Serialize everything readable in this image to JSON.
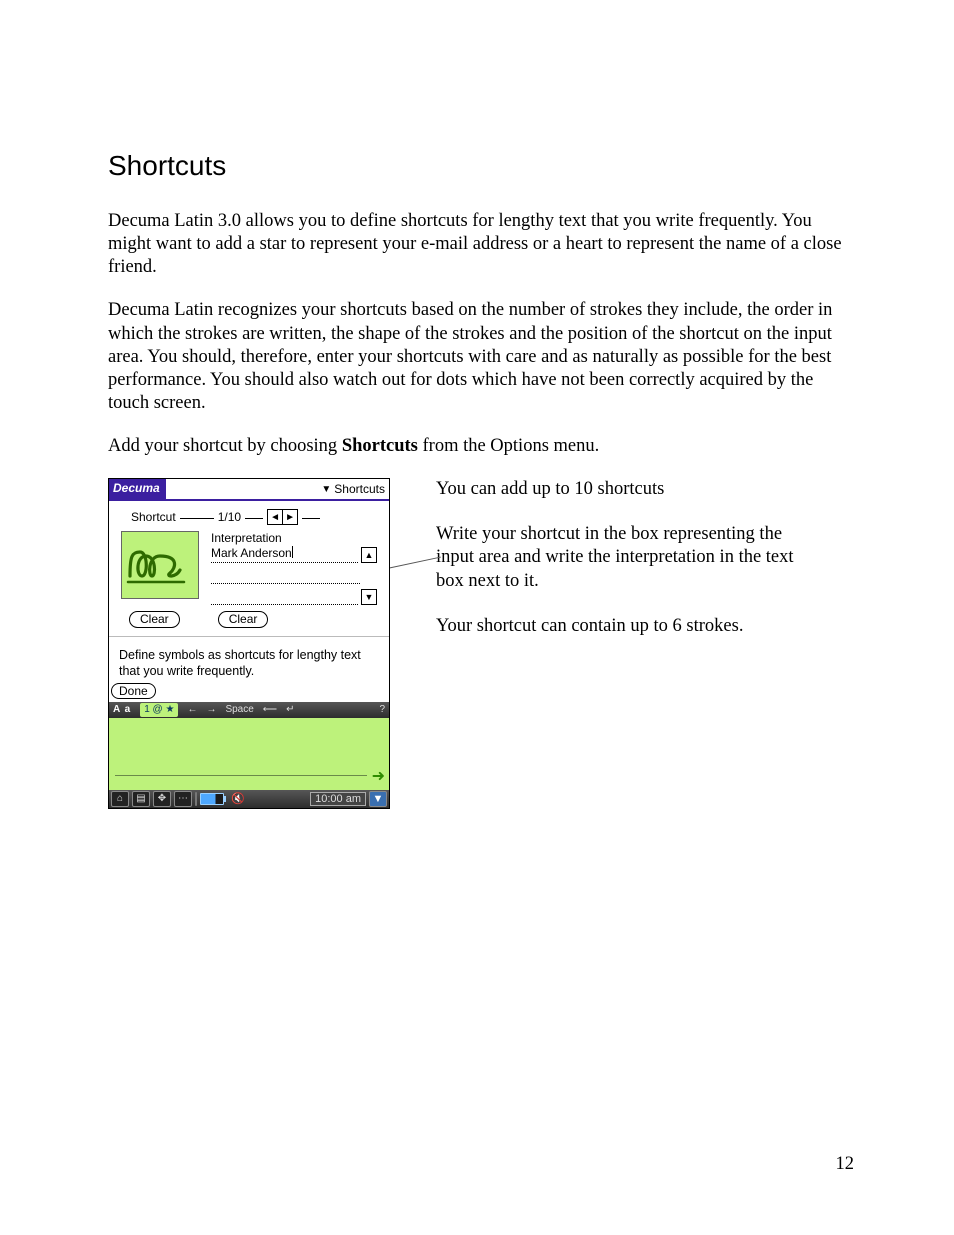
{
  "heading": "Shortcuts",
  "p1": "Decuma Latin 3.0 allows you to define shortcuts for lengthy text that you write frequently. You might want to add a star to represent your e-mail address or a heart to represent the name of a close friend.",
  "p2": "Decuma Latin recognizes your shortcuts based on the number of strokes they include, the order in which the strokes are written, the shape of the strokes and the position of the shortcut on the input area. You should, therefore, enter your shortcuts with care and as naturally as possible for the best performance. You should also watch out for dots which have not been correctly acquired by the touch screen.",
  "p3_pre": "Add your shortcut by choosing ",
  "p3_bold": "Shortcuts",
  "p3_post": " from the Options menu.",
  "side": {
    "n1": "You can add up to 10 shortcuts",
    "n2": "Write your shortcut in the box representing the input area and write the interpretation in the text box next to it.",
    "n3": "Your shortcut can contain up to 6 strokes."
  },
  "device": {
    "brand": "Decuma",
    "menu": "Shortcuts",
    "field_label": "Shortcut",
    "counter": "1/10",
    "interp_label": "Interpretation",
    "interp_value": "Mark Anderson",
    "clear": "Clear",
    "hint": "Define symbols as shortcuts for lengthy text that you write frequently.",
    "done": "Done",
    "mode_aa": "A a",
    "mode_num": "1 @ ★",
    "tb_space": "Space",
    "tb_q": "?",
    "time": "10:00 am"
  },
  "page_number": "12"
}
